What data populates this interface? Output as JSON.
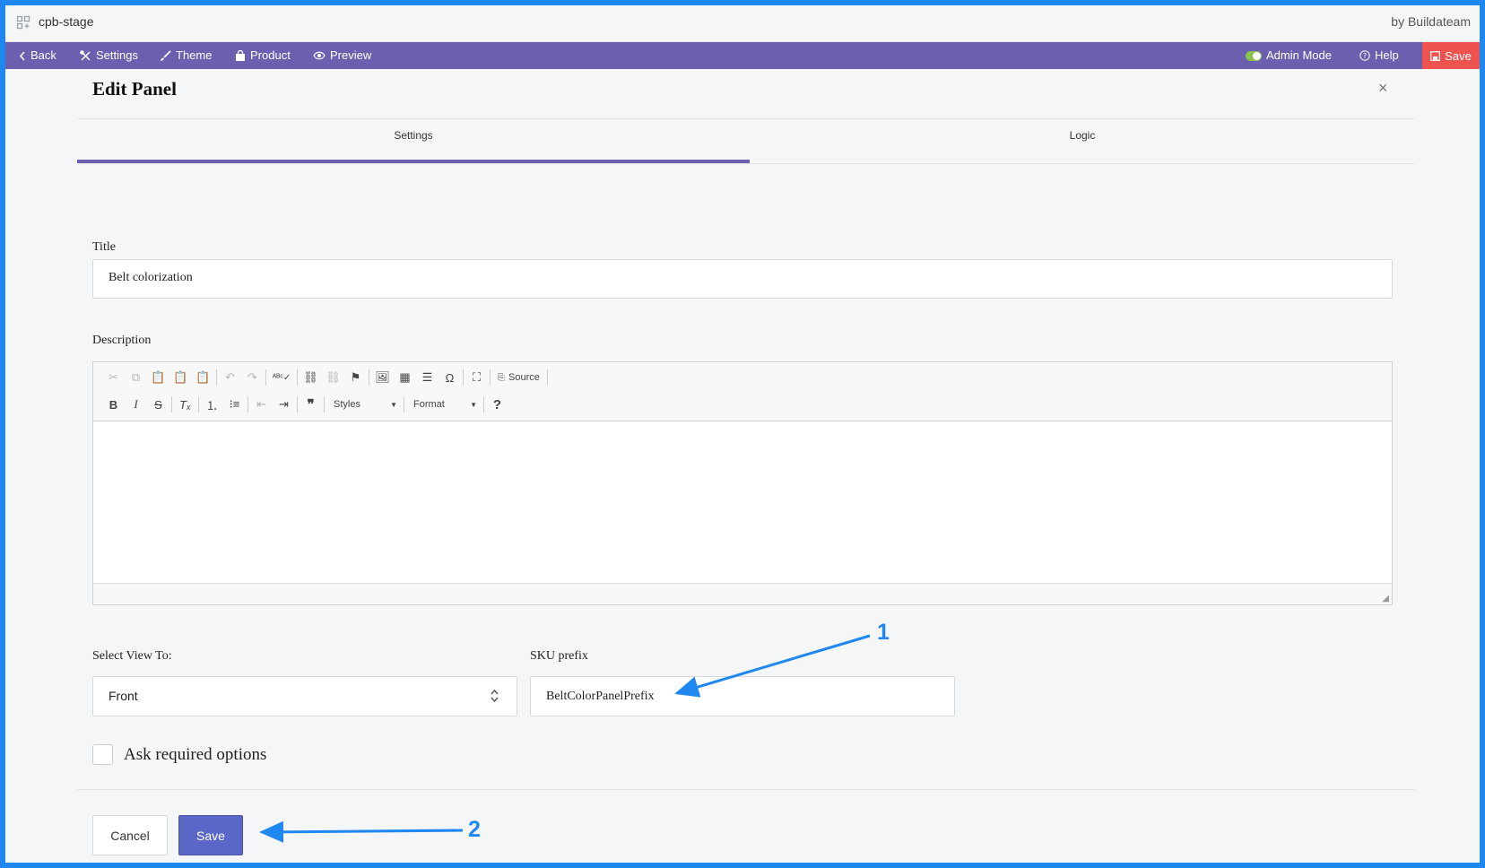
{
  "app": {
    "name": "cpb-stage",
    "brand": "by Buildateam"
  },
  "nav": {
    "back": "Back",
    "settings": "Settings",
    "theme": "Theme",
    "product": "Product",
    "preview": "Preview",
    "admin_mode": "Admin Mode",
    "help": "Help",
    "save": "Save"
  },
  "panel": {
    "title": "Edit Panel",
    "close": "×",
    "tabs": [
      {
        "label": "Settings",
        "active": true
      },
      {
        "label": "Logic",
        "active": false
      }
    ]
  },
  "form": {
    "title_label": "Title",
    "title_value": "Belt colorization",
    "description_label": "Description",
    "editor": {
      "source_label": "Source",
      "styles_label": "Styles",
      "format_label": "Format"
    },
    "view_label": "Select View To:",
    "view_value": "Front",
    "sku_label": "SKU prefix",
    "sku_value": "BeltColorPanelPrefix",
    "ask_required_label": "Ask required options",
    "cancel_label": "Cancel",
    "save_label": "Save"
  },
  "annotations": [
    {
      "label": "1"
    },
    {
      "label": "2"
    }
  ],
  "colors": {
    "accent": "#6c5fb0",
    "save_red": "#ef5350",
    "primary_button": "#5a67c6",
    "annotation": "#1e88f0",
    "toggle_on": "#8bc34a"
  }
}
